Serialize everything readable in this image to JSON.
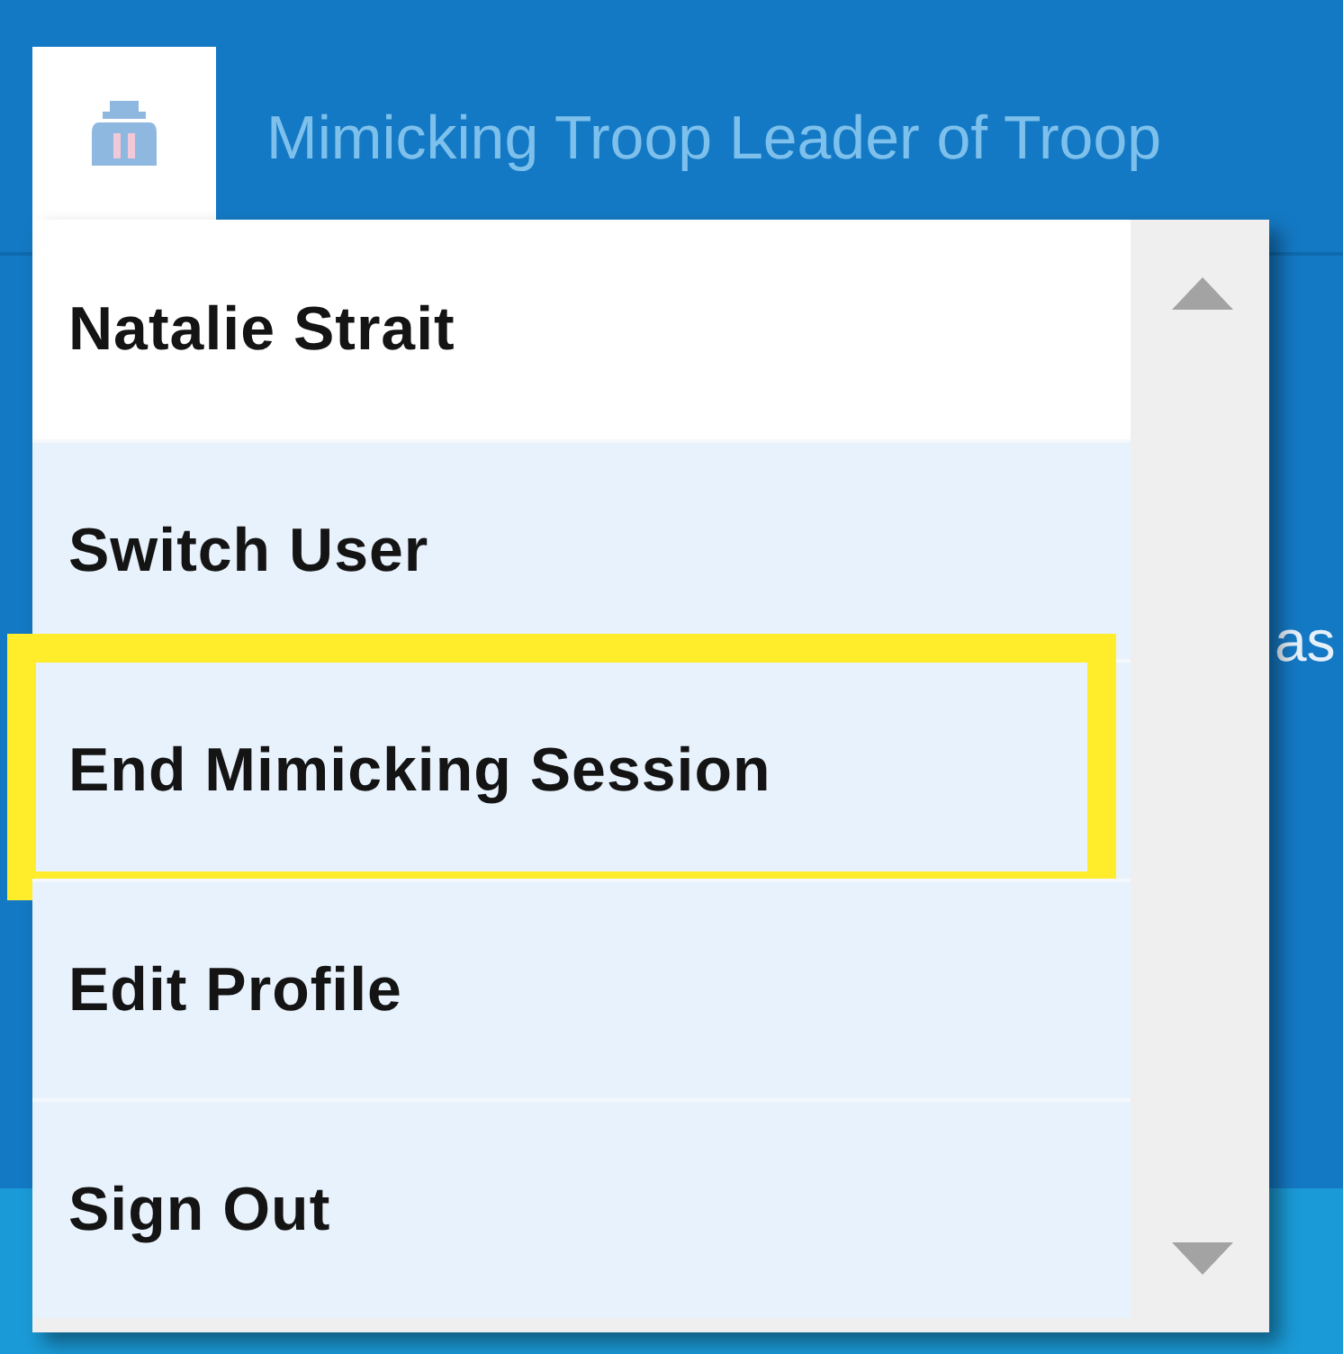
{
  "header": {
    "title": "Mimicking Troop Leader of Troop"
  },
  "background_text": "as",
  "user_menu": {
    "items": [
      {
        "kind": "name",
        "label": "Natalie Strait",
        "highlighted": false
      },
      {
        "kind": "action",
        "label": "Switch User",
        "highlighted": false
      },
      {
        "kind": "action",
        "label": "End Mimicking Session",
        "highlighted": true
      },
      {
        "kind": "action",
        "label": "Edit Profile",
        "highlighted": false
      },
      {
        "kind": "action",
        "label": "Sign Out",
        "highlighted": false
      }
    ]
  }
}
